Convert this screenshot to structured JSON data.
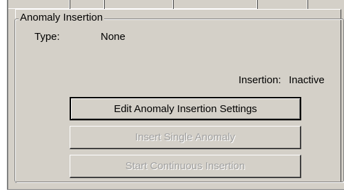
{
  "group": {
    "title": "Anomaly Insertion"
  },
  "fields": {
    "type_label": "Type:",
    "type_value": "None",
    "insertion_label": "Insertion:",
    "insertion_value": "Inactive"
  },
  "buttons": {
    "edit_settings": "Edit Anomaly Insertion Settings",
    "insert_single": "Insert Single Anomaly",
    "start_continuous": "Start Continuous Insertion"
  },
  "state": {
    "insert_single_enabled": false,
    "start_continuous_enabled": false
  }
}
